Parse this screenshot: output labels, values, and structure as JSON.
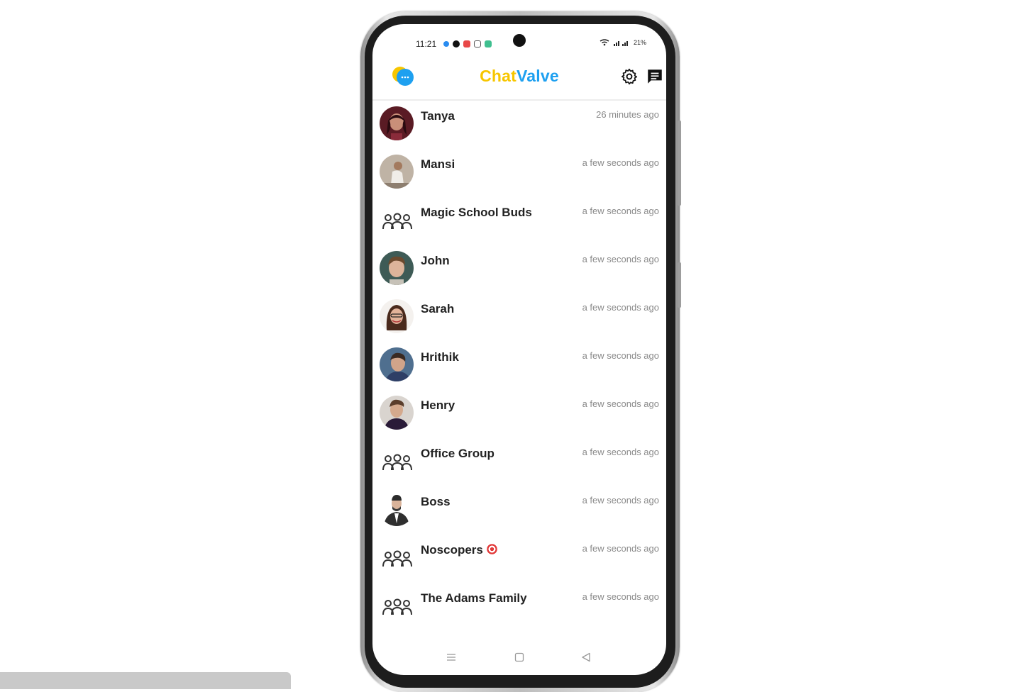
{
  "status_bar": {
    "time": "11:21",
    "battery": "21%"
  },
  "header": {
    "title_part1": "Chat",
    "title_part2": "Valve",
    "logo_icon": "chat-bubbles-logo",
    "settings_icon": "gear-icon",
    "new_chat_icon": "message-icon",
    "colors": {
      "yellow": "#f7c600",
      "blue": "#1ea0f0"
    }
  },
  "chats": [
    {
      "name": "Tanya",
      "time": "26 minutes ago",
      "type": "person"
    },
    {
      "name": "Mansi",
      "time": "a few seconds ago",
      "type": "person"
    },
    {
      "name": "Magic School Buds",
      "time": "a few seconds ago",
      "type": "group"
    },
    {
      "name": "John",
      "time": "a few seconds ago",
      "type": "person"
    },
    {
      "name": "Sarah",
      "time": "a few seconds ago",
      "type": "person"
    },
    {
      "name": "Hrithik",
      "time": "a few seconds ago",
      "type": "person"
    },
    {
      "name": "Henry",
      "time": "a few seconds ago",
      "type": "person"
    },
    {
      "name": "Office Group",
      "time": "a few seconds ago",
      "type": "group"
    },
    {
      "name": "Boss",
      "time": "a few seconds ago",
      "type": "person"
    },
    {
      "name": "Noscopers",
      "time": "a few seconds ago",
      "type": "group",
      "emoji": "target-icon"
    },
    {
      "name": "The Adams Family",
      "time": "a few seconds ago",
      "type": "group"
    }
  ],
  "nav": {
    "menu_icon": "menu-icon",
    "home_icon": "home-square-icon",
    "back_icon": "back-triangle-icon"
  }
}
